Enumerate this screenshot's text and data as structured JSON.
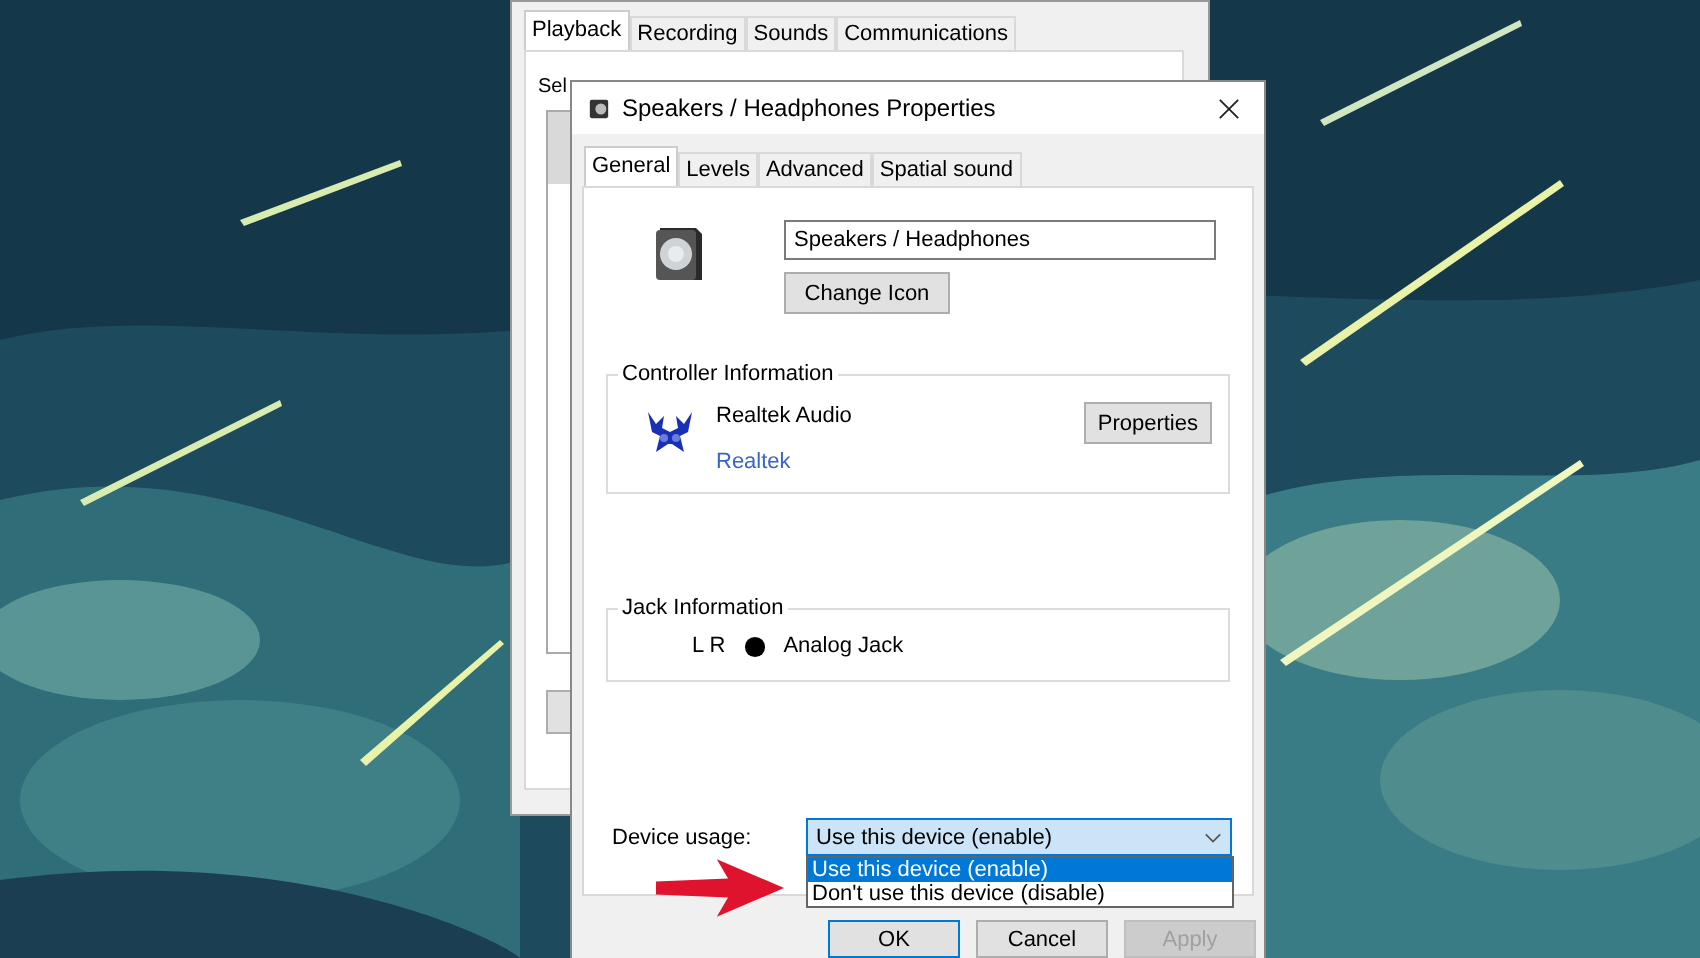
{
  "sound_window": {
    "tabs": [
      {
        "label": "Playback",
        "selected": true
      },
      {
        "label": "Recording",
        "selected": false
      },
      {
        "label": "Sounds",
        "selected": false
      },
      {
        "label": "Communications",
        "selected": false
      }
    ],
    "instruction": "Sel"
  },
  "properties_dialog": {
    "title": "Speakers / Headphones Properties",
    "tabs": [
      {
        "label": "General",
        "selected": true
      },
      {
        "label": "Levels",
        "selected": false
      },
      {
        "label": "Advanced",
        "selected": false
      },
      {
        "label": "Spatial sound",
        "selected": false
      }
    ],
    "name_field": {
      "value": "Speakers / Headphones"
    },
    "change_icon_button": "Change Icon",
    "controller_information": {
      "title": "Controller Information",
      "name": "Realtek Audio",
      "link": "Realtek",
      "properties_button": "Properties"
    },
    "jack_information": {
      "title": "Jack Information",
      "channels": "L R",
      "jack": "Analog Jack"
    },
    "device_usage": {
      "label": "Device usage:",
      "value": "Use this device (enable)",
      "expanded": true,
      "options": [
        {
          "label": "Use this device (enable)",
          "selected": true
        },
        {
          "label": "Don't use this device (disable)",
          "selected": false
        }
      ]
    },
    "buttons": [
      {
        "label": "OK",
        "disabled": false
      },
      {
        "label": "Cancel",
        "disabled": false
      },
      {
        "label": "Apply",
        "disabled": true
      }
    ]
  }
}
